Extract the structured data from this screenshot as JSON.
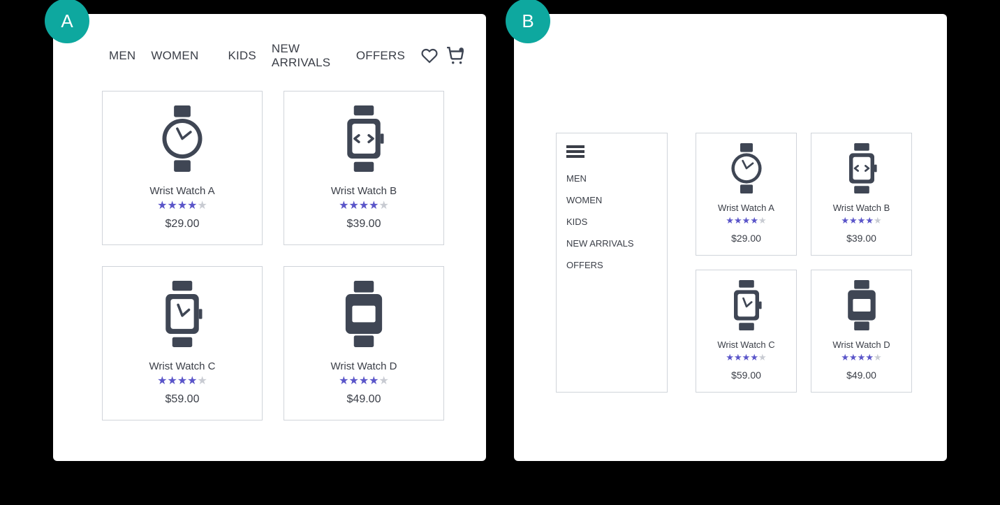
{
  "badges": {
    "a": "A",
    "b": "B"
  },
  "nav": {
    "items": [
      "MEN",
      "WOMEN",
      "KIDS",
      "NEW ARRIVALS",
      "OFFERS"
    ]
  },
  "products": [
    {
      "name": "Wrist Watch A",
      "price": "$29.00",
      "rating": 4,
      "icon": "watch-round"
    },
    {
      "name": "Wrist Watch B",
      "price": "$39.00",
      "rating": 4,
      "icon": "watch-code"
    },
    {
      "name": "Wrist Watch C",
      "price": "$59.00",
      "rating": 4,
      "icon": "watch-square-time"
    },
    {
      "name": "Wrist Watch D",
      "price": "$49.00",
      "rating": 4,
      "icon": "watch-square-solid"
    }
  ]
}
